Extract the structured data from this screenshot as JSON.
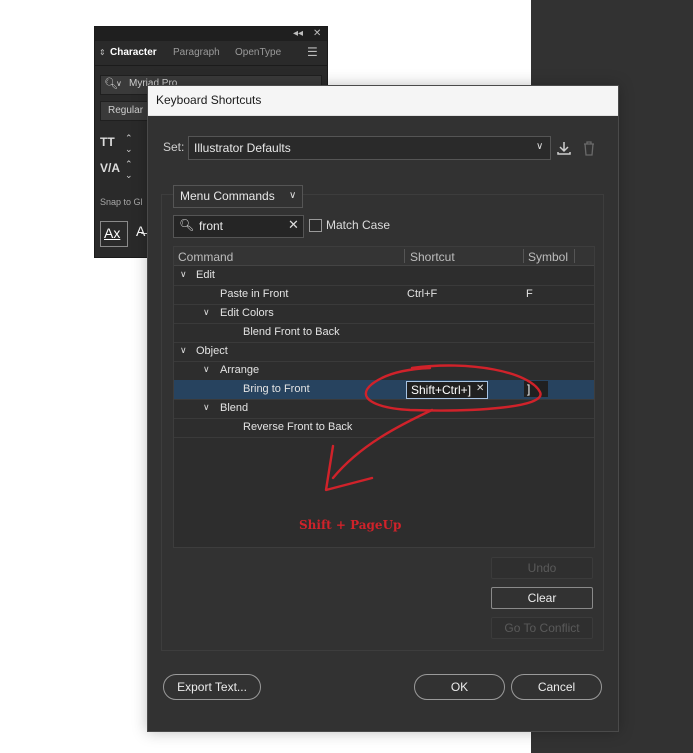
{
  "character_panel": {
    "tabs": [
      "Character",
      "Paragraph",
      "OpenType"
    ],
    "font_family": "Myriad Pro",
    "font_style": "Regular",
    "snap_label": "Snap to Gl",
    "ax_label": "Ax"
  },
  "dialog": {
    "title": "Keyboard Shortcuts",
    "set_label": "Set:",
    "set_value": "Illustrator Defaults",
    "category_value": "Menu Commands",
    "search_value": "front",
    "match_case_label": "Match Case",
    "columns": [
      "Command",
      "Shortcut",
      "Symbol"
    ],
    "rows": [
      {
        "label": "Edit",
        "shortcut": "",
        "symbol": ""
      },
      {
        "label": "Paste in Front",
        "shortcut": "Ctrl+F",
        "symbol": "F"
      },
      {
        "label": "Edit Colors",
        "shortcut": "",
        "symbol": ""
      },
      {
        "label": "Blend Front to Back",
        "shortcut": "",
        "symbol": ""
      },
      {
        "label": "Object",
        "shortcut": "",
        "symbol": ""
      },
      {
        "label": "Arrange",
        "shortcut": "",
        "symbol": ""
      },
      {
        "label": "Bring to Front",
        "shortcut": "Shift+Ctrl+]",
        "symbol": "]"
      },
      {
        "label": "Blend",
        "shortcut": "",
        "symbol": ""
      },
      {
        "label": "Reverse Front to Back",
        "shortcut": "",
        "symbol": ""
      }
    ],
    "buttons": {
      "undo": "Undo",
      "clear": "Clear",
      "go_to_conflict": "Go To Conflict",
      "export_text": "Export Text...",
      "ok": "OK",
      "cancel": "Cancel"
    }
  },
  "annotation_text": "Shift + PageUp",
  "colors": {
    "dialog_bg": "#323232",
    "selection": "#27435f",
    "annotation_red": "#d0222a"
  }
}
